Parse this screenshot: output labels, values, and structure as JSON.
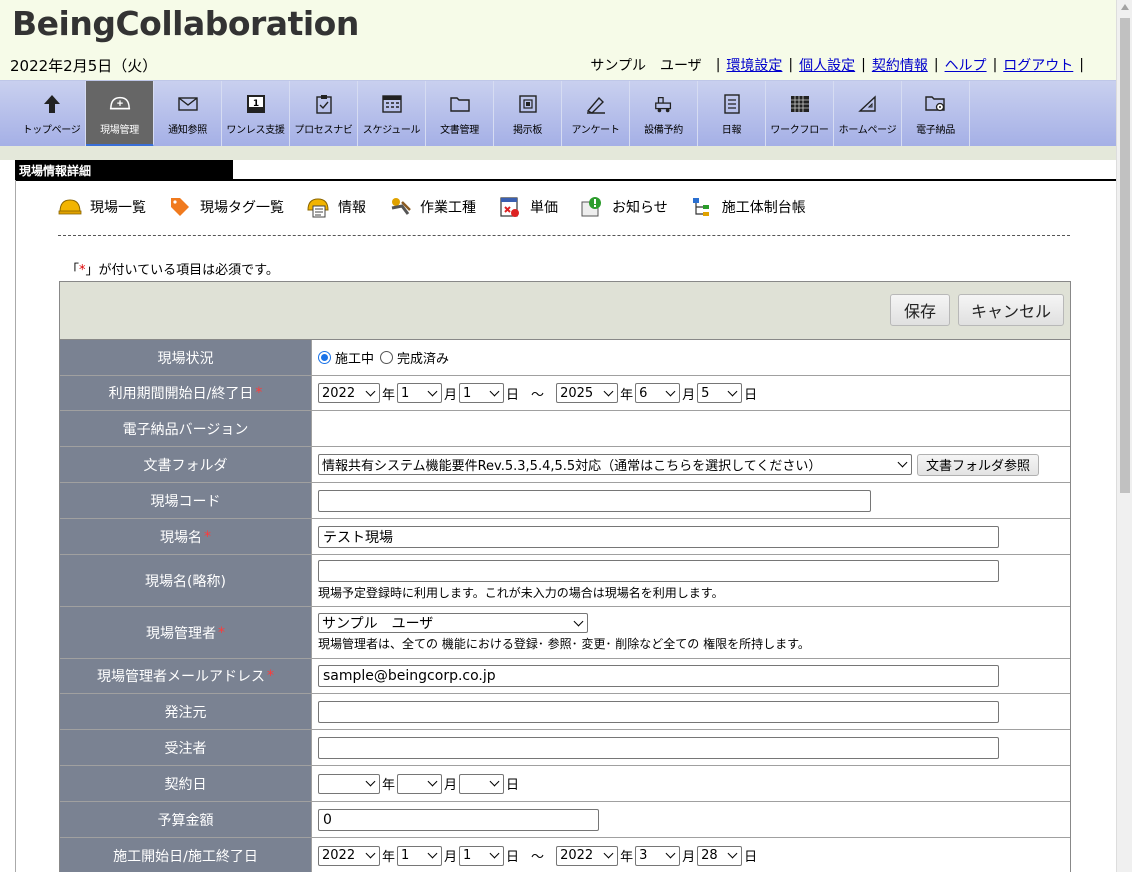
{
  "app": {
    "logo": "BeingCollaboration"
  },
  "header": {
    "date": "2022年2月5日（火）",
    "user_name": "サンプル　ユーザ",
    "links": [
      "環境設定",
      "個人設定",
      "契約情報",
      "ヘルプ",
      "ログアウト"
    ]
  },
  "nav": {
    "items": [
      {
        "label": "トップページ",
        "icon": "up-arrow-icon"
      },
      {
        "label": "現場管理",
        "icon": "helmet-icon",
        "active": true
      },
      {
        "label": "通知参照",
        "icon": "mail-icon"
      },
      {
        "label": "ワンレス支援",
        "icon": "calendar-day-icon"
      },
      {
        "label": "プロセスナビ",
        "icon": "clipboard-icon"
      },
      {
        "label": "スケジュール",
        "icon": "schedule-icon"
      },
      {
        "label": "文書管理",
        "icon": "folder-icon"
      },
      {
        "label": "掲示板",
        "icon": "board-icon"
      },
      {
        "label": "アンケート",
        "icon": "pen-icon"
      },
      {
        "label": "設備予約",
        "icon": "machine-icon"
      },
      {
        "label": "日報",
        "icon": "report-icon"
      },
      {
        "label": "ワークフロー",
        "icon": "grid-icon"
      },
      {
        "label": "ホームページ",
        "icon": "triangle-ruler-icon"
      },
      {
        "label": "電子納品",
        "icon": "folder-gear-icon"
      }
    ]
  },
  "section": {
    "title": "現場情報詳細"
  },
  "subnav": {
    "items": [
      {
        "label": "現場一覧",
        "icon": "helmet-icon"
      },
      {
        "label": "現場タグ一覧",
        "icon": "tag-icon"
      },
      {
        "label": "情報",
        "icon": "info-helmet-icon"
      },
      {
        "label": "作業工種",
        "icon": "worker-icon"
      },
      {
        "label": "単価",
        "icon": "price-icon"
      },
      {
        "label": "お知らせ",
        "icon": "notice-icon"
      },
      {
        "label": "施工体制台帳",
        "icon": "tree-icon"
      }
    ]
  },
  "required_note": {
    "prefix": "「",
    "mark": "*",
    "suffix": "」が付いている項目は必須です。"
  },
  "buttons": {
    "save": "保存",
    "cancel": "キャンセル",
    "folder_browse": "文書フォルダ参照"
  },
  "units": {
    "year": "年",
    "month": "月",
    "day": "日",
    "tilde": "～"
  },
  "form": {
    "status": {
      "label": "現場状況",
      "options": [
        "施工中",
        "完成済み"
      ],
      "selected": "施工中"
    },
    "period": {
      "label": "利用期間開始日/終了日",
      "start": {
        "y": "2022",
        "m": "1",
        "d": "1"
      },
      "end": {
        "y": "2025",
        "m": "6",
        "d": "5"
      }
    },
    "edelivery_version": {
      "label": "電子納品バージョン",
      "value": ""
    },
    "doc_folder": {
      "label": "文書フォルダ",
      "value": "情報共有システム機能要件Rev.5.3,5.4,5.5対応（通常はこちらを選択してください）"
    },
    "site_code": {
      "label": "現場コード",
      "value": ""
    },
    "site_name": {
      "label": "現場名",
      "value": "テスト現場"
    },
    "site_short": {
      "label": "現場名(略称)",
      "value": "",
      "help": "現場予定登録時に利用します。これが未入力の場合は現場名を利用します。"
    },
    "manager": {
      "label": "現場管理者",
      "value": "サンプル　ユーザ",
      "help": "現場管理者は、全ての 機能における登録･ 参照･ 変更･ 削除など全ての 権限を所持します。"
    },
    "manager_email": {
      "label": "現場管理者メールアドレス",
      "value": "sample@beingcorp.co.jp"
    },
    "orderer": {
      "label": "発注元",
      "value": ""
    },
    "contractor": {
      "label": "受注者",
      "value": ""
    },
    "contract_date": {
      "label": "契約日",
      "y": "",
      "m": "",
      "d": ""
    },
    "budget": {
      "label": "予算金額",
      "value": "0"
    },
    "construction": {
      "label": "施工開始日/施工終了日",
      "start": {
        "y": "2022",
        "m": "1",
        "d": "1"
      },
      "end": {
        "y": "2022",
        "m": "3",
        "d": "28"
      }
    }
  }
}
